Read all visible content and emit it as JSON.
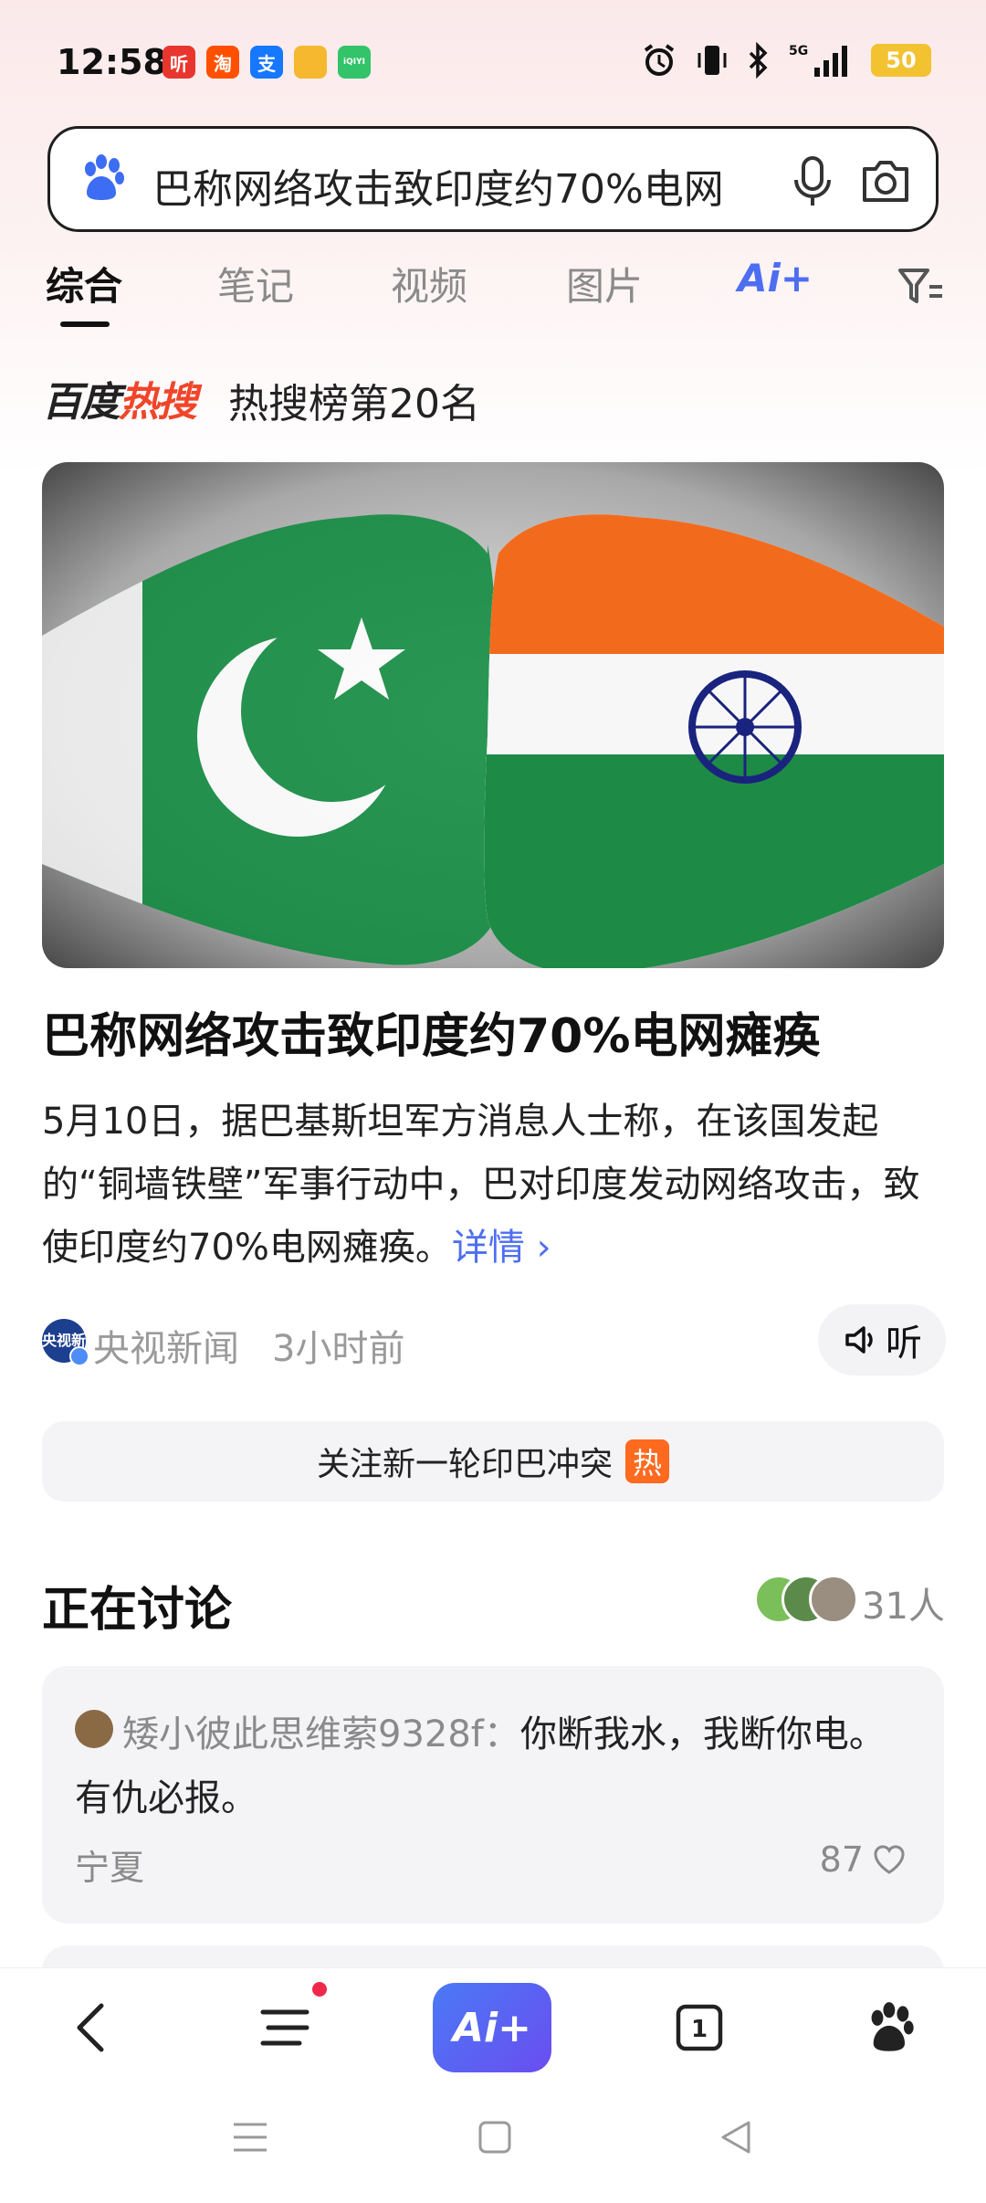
{
  "status_bar": {
    "time": "12:58",
    "battery": "50",
    "network": "5G",
    "app_icons": [
      {
        "name": "ting-icon",
        "glyph": "听",
        "color": "#e8362e"
      },
      {
        "name": "taobao-icon",
        "glyph": "淘",
        "color": "#ff5000"
      },
      {
        "name": "alipay-icon",
        "glyph": "支",
        "color": "#1677ff"
      },
      {
        "name": "shield-app-icon",
        "glyph": "",
        "color": "#f5b82e"
      },
      {
        "name": "iqiyi-icon",
        "glyph": "iQIYI",
        "color": "#33c46a"
      }
    ]
  },
  "search": {
    "query": "巴称网络攻击致印度约70%电网"
  },
  "tabs": [
    {
      "label": "综合",
      "active": true
    },
    {
      "label": "笔记",
      "active": false
    },
    {
      "label": "视频",
      "active": false
    },
    {
      "label": "图片",
      "active": false
    }
  ],
  "ai_tab_label": "Ai+",
  "hot": {
    "brand_prefix": "百度",
    "brand_suffix": "热搜",
    "rank": "热搜榜第20名"
  },
  "article": {
    "headline": "巴称网络攻击致印度约70%电网瘫痪",
    "summary": "5月10日，据巴基斯坦军方消息人士称，在该国发起的“铜墙铁壁”军事行动中，巴对印度发动网络攻击，致使印度约70%电网瘫痪。",
    "more_link": "详情",
    "source_name": "央视新闻",
    "source_avatar_text": "央视新",
    "time": "3小时前",
    "listen_label": "听"
  },
  "follow": {
    "label": "关注新一轮印巴冲突",
    "tag": "热"
  },
  "discussion": {
    "title": "正在讨论",
    "count": "31人",
    "comment": {
      "user": "矮小彼此思维萦9328f：",
      "text": "你断我水，我断你电。有仇必报。",
      "location": "宁夏",
      "likes": "87"
    }
  },
  "bottom_nav": {
    "ai_label": "Ai+",
    "tab_count": "1"
  }
}
